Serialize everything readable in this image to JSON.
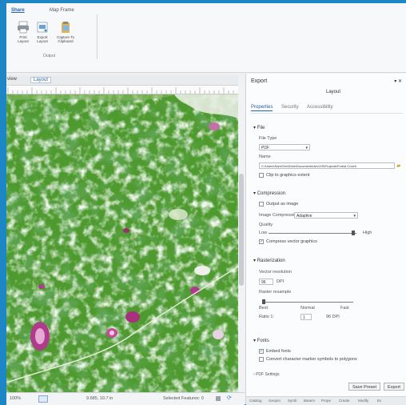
{
  "ribbon": {
    "tabs": [
      "Share",
      "Map Frame"
    ],
    "buttons": [
      {
        "label": "Print Layout",
        "icon": "printer-icon"
      },
      {
        "label": "Export Layout",
        "icon": "export-icon"
      },
      {
        "label": "Capture To Clipboard",
        "icon": "clipboard-icon"
      }
    ],
    "group_label": "Output"
  },
  "map_pane": {
    "tabs": [
      "view",
      "Layout"
    ],
    "status": {
      "zoom": "100% ",
      "coords": "9.685, 10.7 in",
      "selected": "Selected Features: 0"
    }
  },
  "export": {
    "title": "Export",
    "subtitle": "Layout",
    "tabs": [
      "Properties",
      "Security",
      "Accessibility"
    ],
    "file": {
      "section": "File",
      "file_type_label": "File Type",
      "file_type": "PDF",
      "name_label": "Name",
      "name": "C:\\Users\\Sam\\OneDrive\\Documents\\ArcGIS\\Projects\\Forest Cover\\",
      "clip_label": "Clip to graphics extent"
    },
    "compression": {
      "section": "Compression",
      "output_image_label": "Output as image",
      "image_compression_label": "Image Compression",
      "image_compression": "Adaptive",
      "quality_label": "Quality",
      "quality_low": "Low",
      "quality_high": "High",
      "compress_vector_label": "Compress vector graphics"
    },
    "resolution": {
      "section": "Rasterization",
      "vector_res_label": "Vector resolution",
      "vector_res": "96",
      "dpi": "DPI",
      "raster_label": "Raster resample",
      "best": "Best",
      "normal": "Normal",
      "fast": "Fast",
      "ratio_label": "Ratio 1:",
      "ratio": "1",
      "ratio_dpi": "96 DPI"
    },
    "fonts": {
      "section": "Fonts",
      "embed_label": "Embed fonts",
      "convert_label": "Convert character marker symbols to polygons"
    },
    "pdf_settings": "PDF Settings",
    "buttons": {
      "save": "Save Preset",
      "export": "Export"
    },
    "bottom_tabs": [
      "Catalog",
      "Geopro",
      "Symb",
      "Basem",
      "Prope",
      "Create",
      "Modify",
      "Ex"
    ]
  }
}
